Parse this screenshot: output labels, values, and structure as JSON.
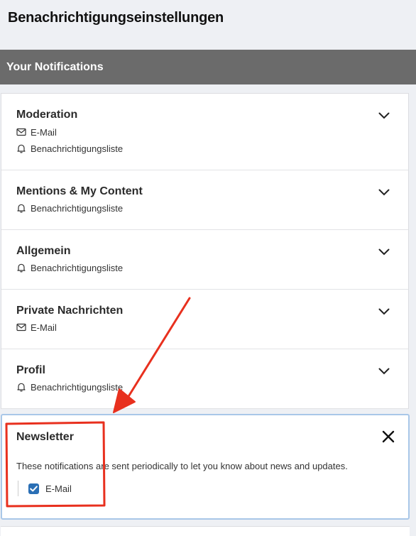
{
  "page": {
    "title": "Benachrichtigungseinstellungen"
  },
  "section": {
    "title": "Your Notifications"
  },
  "categories": [
    {
      "title": "Moderation",
      "channels": [
        {
          "icon": "envelope-icon",
          "label": "E-Mail"
        },
        {
          "icon": "bell-icon",
          "label": "Benachrichtigungsliste"
        }
      ]
    },
    {
      "title": "Mentions & My Content",
      "channels": [
        {
          "icon": "bell-icon",
          "label": "Benachrichtigungsliste"
        }
      ]
    },
    {
      "title": "Allgemein",
      "channels": [
        {
          "icon": "bell-icon",
          "label": "Benachrichtigungsliste"
        }
      ]
    },
    {
      "title": "Private Nachrichten",
      "channels": [
        {
          "icon": "envelope-icon",
          "label": "E-Mail"
        }
      ]
    },
    {
      "title": "Profil",
      "channels": [
        {
          "icon": "bell-icon",
          "label": "Benachrichtigungsliste"
        }
      ]
    }
  ],
  "expanded": {
    "title": "Newsletter",
    "description": "These notifications are sent periodically to let you know about news and updates.",
    "option": {
      "label": "E-Mail",
      "checked": true
    }
  },
  "colors": {
    "section_bar": "#6b6b6b",
    "checkbox": "#2a6fb5",
    "panel_border": "#a9c7e8",
    "annotation": "#e8301e"
  }
}
